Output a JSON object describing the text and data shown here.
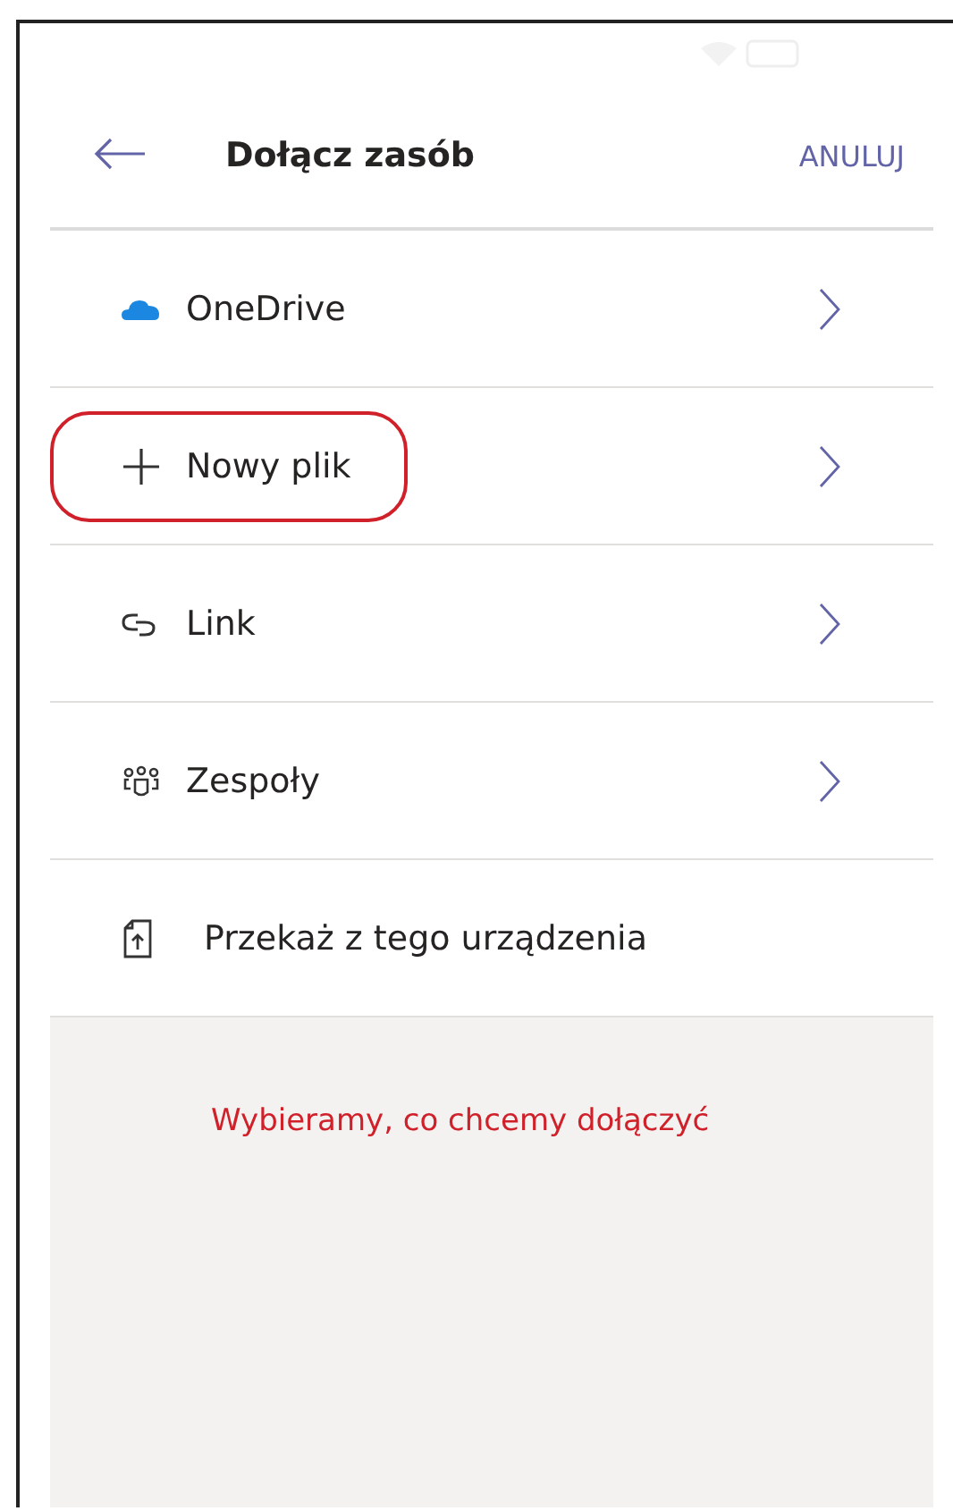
{
  "header": {
    "title": "Dołącz zasób",
    "action": "ANULUJ"
  },
  "items": [
    {
      "label": "OneDrive",
      "kind": "cloud",
      "chevron": true,
      "highlighted": false
    },
    {
      "label": "Nowy plik",
      "kind": "plus",
      "chevron": true,
      "highlighted": true
    },
    {
      "label": "Link",
      "kind": "link",
      "chevron": true,
      "highlighted": false
    },
    {
      "label": "Zespoły",
      "kind": "teams",
      "chevron": true,
      "highlighted": false
    },
    {
      "label": "Przekaż z tego urządzenia",
      "kind": "upload",
      "chevron": false,
      "highlighted": false
    }
  ],
  "annotation": "Wybieramy, co chcemy dołączyć"
}
